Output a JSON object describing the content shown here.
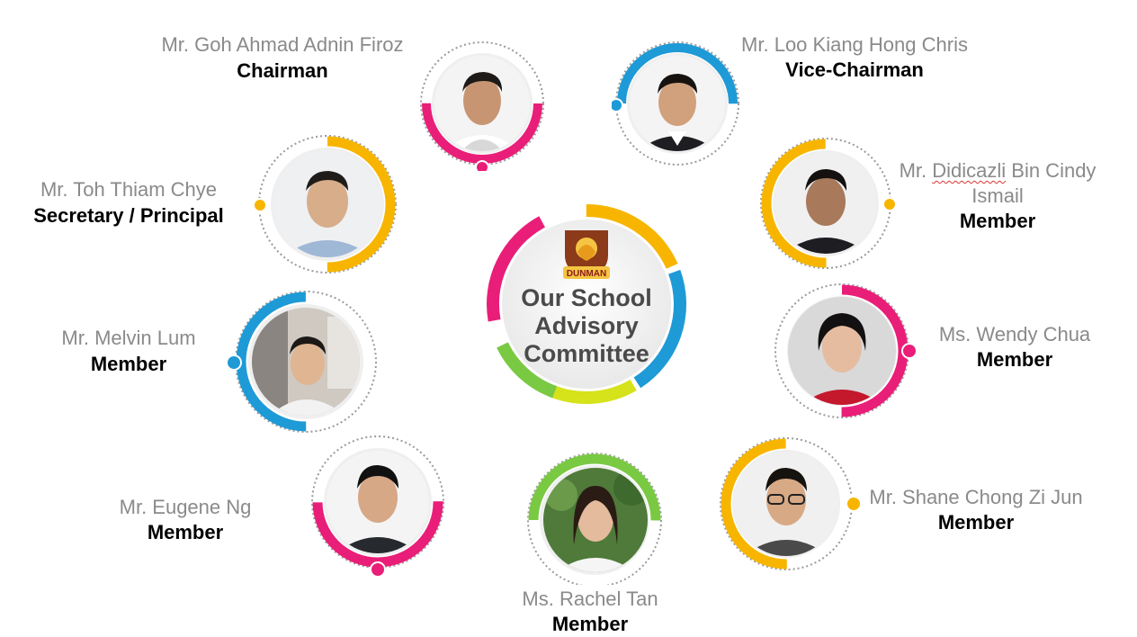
{
  "center": {
    "title_lines": [
      "Our School",
      "Advisory",
      "Committee"
    ],
    "crest_text": "DUNMAN"
  },
  "members": [
    {
      "name": "Mr. Goh Ahmad Adnin Firoz",
      "role": "Chairman",
      "accent": "#e91e78"
    },
    {
      "name": "Mr. Loo Kiang Hong Chris",
      "role": "Vice-Chairman",
      "accent": "#1e9ad6"
    },
    {
      "name": "Mr. Toh Thiam Chye",
      "role": "Secretary / Principal",
      "accent": "#f7b500"
    },
    {
      "name_pre": "Mr. ",
      "name_word": "Didicazli",
      "name_post": " Bin Cindy",
      "name_line2": "Ismail",
      "role": "Member",
      "accent": "#f7b500"
    },
    {
      "name": "Mr. Melvin Lum",
      "role": "Member",
      "accent": "#1e9ad6"
    },
    {
      "name": "Ms. Wendy Chua",
      "role": "Member",
      "accent": "#e91e78"
    },
    {
      "name": "Mr. Eugene Ng",
      "role": "Member",
      "accent": "#e91e78"
    },
    {
      "name": "Ms. Rachel Tan",
      "role": "Member",
      "accent": "#7ac943"
    },
    {
      "name": "Mr. Shane Chong Zi Jun",
      "role": "Member",
      "accent": "#f7b500"
    }
  ]
}
